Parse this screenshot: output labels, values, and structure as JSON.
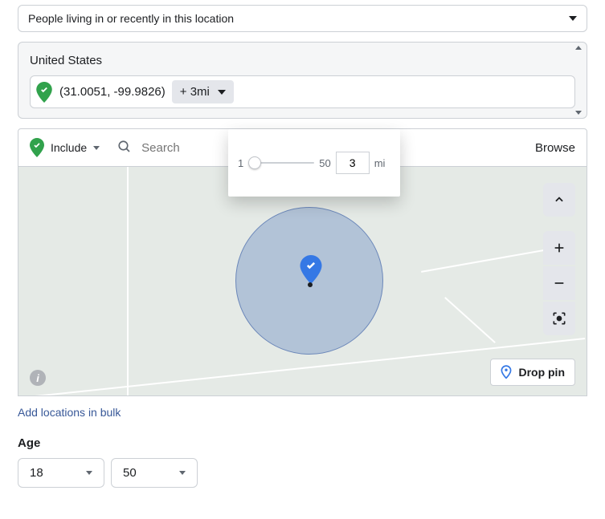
{
  "audience_type": {
    "label": "People living in or recently in this location"
  },
  "location": {
    "country": "United States",
    "pin_coords": "(31.0051, -99.9826)",
    "radius_chip": "+ 3mi"
  },
  "radius_popover": {
    "min": "1",
    "max": "50",
    "value": "3",
    "unit": "mi"
  },
  "toolbar": {
    "include_label": "Include",
    "search_placeholder": "Search",
    "browse_label": "Browse"
  },
  "map": {
    "drop_pin_label": "Drop pin"
  },
  "bulk_link": "Add locations in bulk",
  "age": {
    "label": "Age",
    "min": "18",
    "max": "50"
  }
}
